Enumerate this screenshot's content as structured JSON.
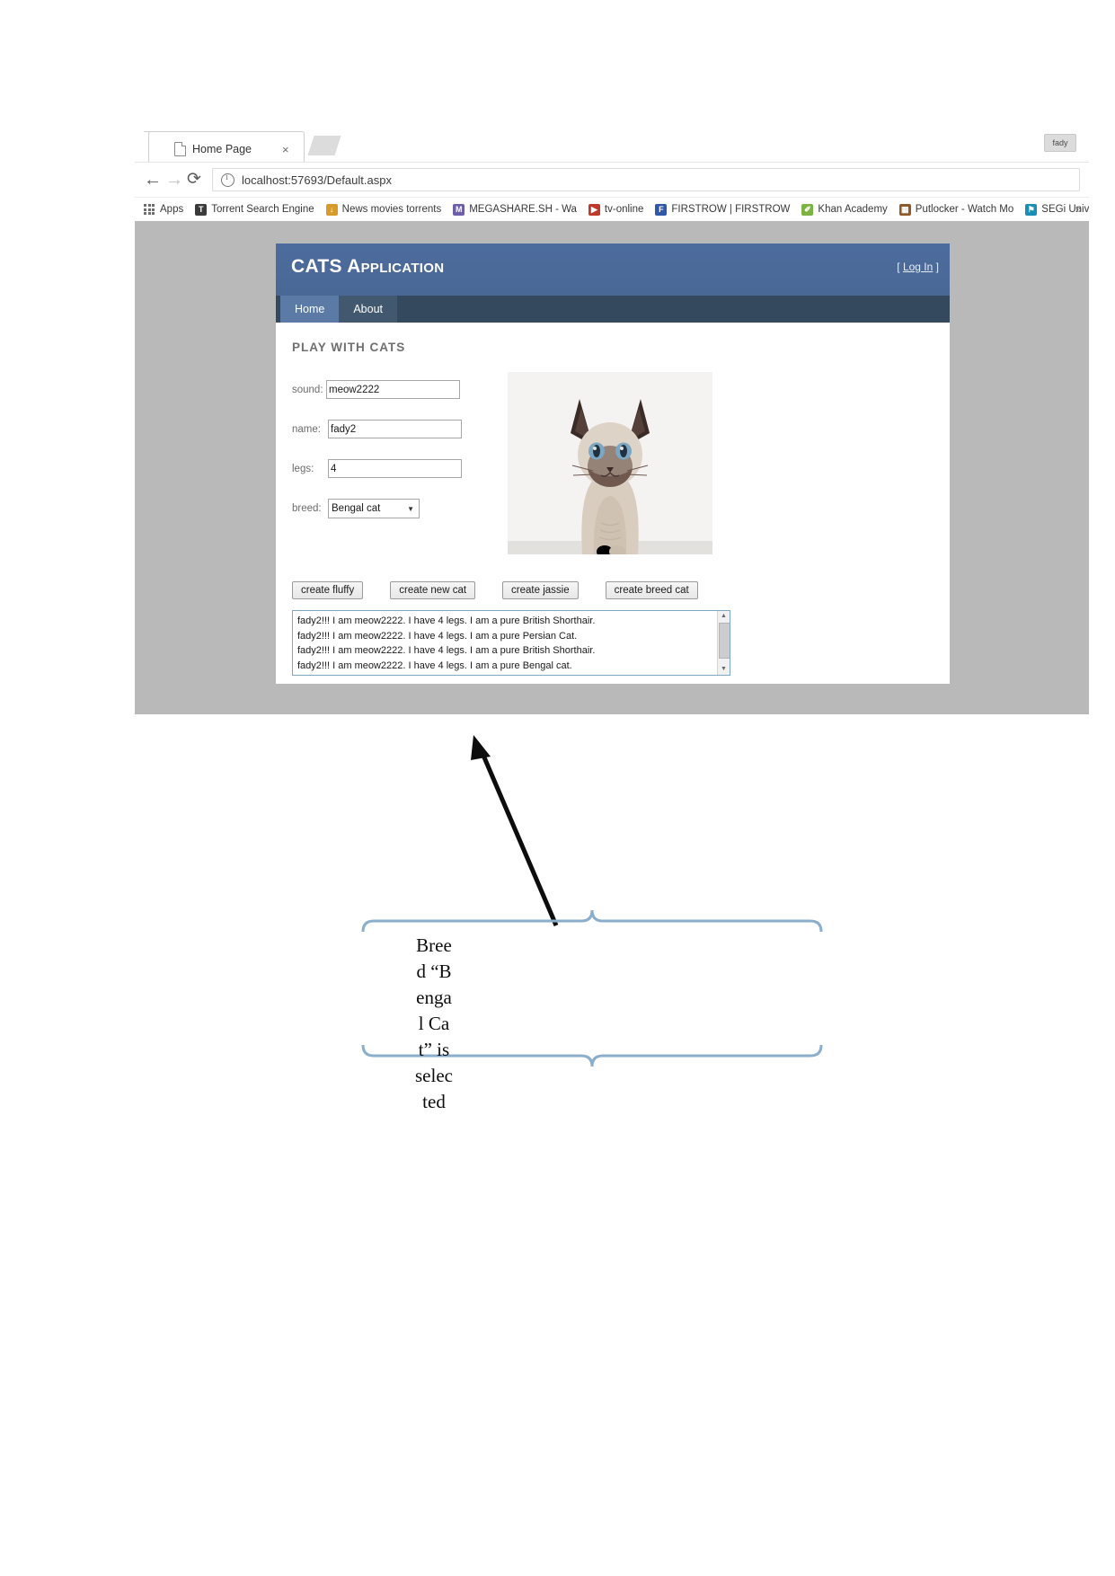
{
  "browser": {
    "tab": {
      "title": "Home Page",
      "close_label": "×",
      "page_icon": "page-icon"
    },
    "nav": {
      "back": "←",
      "forward": "→",
      "reload": "⟳",
      "security_icon": "info-icon",
      "url": "localhost:57693/Default.aspx"
    },
    "profile": "fady",
    "bookmarks": {
      "apps_label": "Apps",
      "overflow": "»",
      "items": [
        {
          "label": "Torrent Search Engine",
          "glyph": "T",
          "color": "#3a3a3a"
        },
        {
          "label": "News movies torrents",
          "glyph": "↓",
          "color": "#d79b2a"
        },
        {
          "label": "MEGASHARE.SH - Wa",
          "glyph": "M",
          "color": "#6d5fa8"
        },
        {
          "label": "tv-online",
          "glyph": "▶",
          "color": "#c0392b"
        },
        {
          "label": "FIRSTROW | FIRSTROW",
          "glyph": "F",
          "color": "#2f58a8"
        },
        {
          "label": "Khan Academy",
          "glyph": "✐",
          "color": "#7cb342"
        },
        {
          "label": "Putlocker - Watch Mo",
          "glyph": "▦",
          "color": "#8d5a2b"
        },
        {
          "label": "SEGi University - Awa",
          "glyph": "⚑",
          "color": "#1b8fb3"
        }
      ]
    }
  },
  "app": {
    "title": "CATS Application",
    "login_label": "Log In",
    "login_bracket_left": "[",
    "login_bracket_right": "]",
    "navtabs": [
      {
        "label": "Home",
        "active": true
      },
      {
        "label": "About",
        "active": false
      }
    ],
    "section_title": "PLAY WITH CATS",
    "form": {
      "fields": [
        {
          "label": "sound:",
          "value": "meow2222"
        },
        {
          "label": "name:",
          "value": "fady2"
        },
        {
          "label": "legs:",
          "value": "4"
        }
      ],
      "breed": {
        "label": "breed:",
        "value": "Bengal cat",
        "caret": "▼",
        "options": [
          "Bengal cat",
          "British Shorthair",
          "Persian Cat"
        ]
      }
    },
    "buttons": [
      "create fluffy",
      "create new cat",
      "create jassie",
      "create breed cat"
    ],
    "output": {
      "lines": [
        "fady2!!! I am meow2222. I have 4 legs. I am a pure British Shorthair.",
        "fady2!!! I am meow2222. I have 4 legs. I am a pure Persian Cat.",
        "fady2!!! I am meow2222. I have 4 legs. I am a pure British Shorthair.",
        "fady2!!! I am meow2222. I have 4 legs. I am a pure Bengal cat."
      ],
      "scroll_up": "▲",
      "scroll_down": "▼"
    },
    "cat_image_alt": "siamese-kitten-photo"
  },
  "annotation": {
    "text": "Breed “Bengal Cat” is selected"
  },
  "colors": {
    "header_blue": "#4c6c9e",
    "nav_dark": "#34495e",
    "active_tab": "#5b7ba6",
    "viewport_gray": "#b9b9b9",
    "callout_blue": "#8aaecb"
  }
}
